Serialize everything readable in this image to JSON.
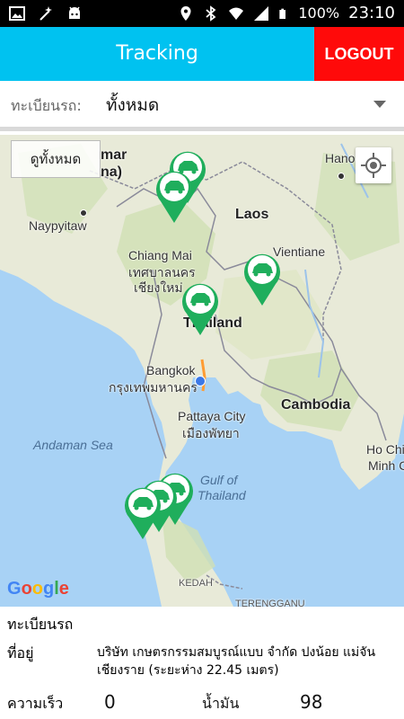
{
  "status_bar": {
    "battery": "100%",
    "time": "23:10"
  },
  "app_bar": {
    "title": "Tracking",
    "logout_label": "LOGOUT"
  },
  "selector": {
    "label": "ทะเบียนรถ:",
    "value": "ทั้งหมด"
  },
  "map": {
    "show_all_label": "ดูทั้งหมด",
    "labels": {
      "myanmar": "mar",
      "myanmar2": "na)",
      "hanoi": "Hanoi",
      "laos": "Laos",
      "naypyitaw": "Naypyitaw",
      "vientiane": "Vientiane",
      "chiang_mai": "Chiang Mai",
      "chiang_mai_th": "เชียงใหม่",
      "chiang_mai_th2": "เทศบาลนคร",
      "thailand": "Thailand",
      "bangkok": "Bangkok",
      "bangkok_th": "กรุงเทพมหานคร",
      "pattaya": "Pattaya City",
      "pattaya_th": "เมืองพัทยา",
      "cambodia": "Cambodia",
      "andaman": "Andaman Sea",
      "gulf1": "Gulf of",
      "gulf2": "Thailand",
      "hochi1": "Ho Chi",
      "hochi2": "Minh C",
      "kedah": "KEDAH",
      "terengganu": "TERENGGANU",
      "google": "Google"
    }
  },
  "info": {
    "plate_label": "ทะเบียนรถ",
    "address_label": "ที่อยู่",
    "address_value": "บริษัท เกษตรกรรมสมบูรณ์แบบ จำกัด ปงน้อย แม่จัน เชียงราย (ระยะห่าง 22.45 เมตร)",
    "speed_label": "ความเร็ว",
    "speed_value": "0",
    "fuel_label": "น้ำมัน",
    "fuel_value": "98"
  }
}
